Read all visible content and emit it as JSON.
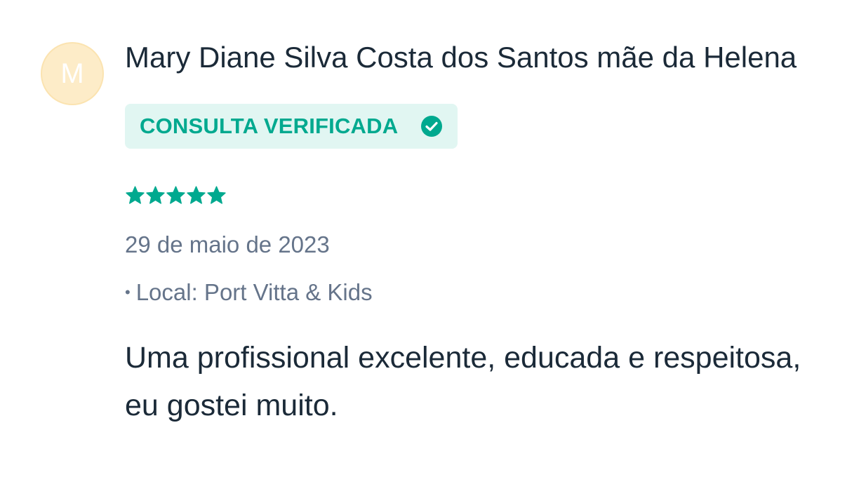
{
  "review": {
    "avatar_letter": "M",
    "author": "Mary Diane Silva Costa dos Santos mãe da Helena",
    "badge_label": "CONSULTA VERIFICADA",
    "rating": 5,
    "rating_max": 5,
    "date": "29 de maio de 2023",
    "location_bullet": "•",
    "location": "Local: Port Vitta & Kids",
    "comment": "Uma profissional excelente, educada e respeitosa, eu gostei muito."
  },
  "colors": {
    "accent": "#00a98f",
    "badge_bg": "#e1f6f2",
    "avatar_bg": "#fdecc8",
    "text_primary": "#1b2a38",
    "text_secondary": "#65748a"
  },
  "icons": {
    "verified": "check-circle-icon",
    "star": "star-icon"
  }
}
